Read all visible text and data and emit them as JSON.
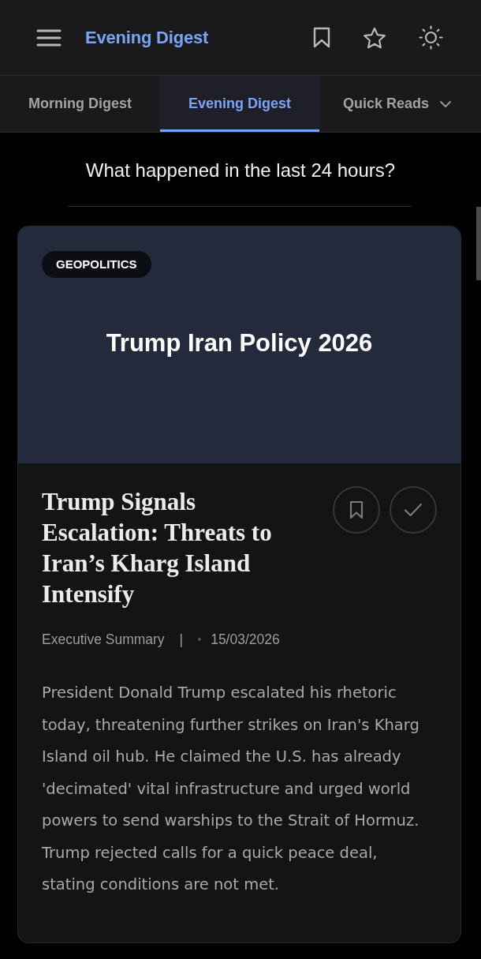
{
  "header": {
    "title": "Evening Digest"
  },
  "tabs": [
    {
      "label": "Morning Digest",
      "selected": false,
      "kind": "tab"
    },
    {
      "label": "Evening Digest",
      "selected": true,
      "kind": "tab"
    },
    {
      "label": "Quick Reads",
      "selected": false,
      "kind": "dropdown"
    }
  ],
  "subtitle": "What happened in the last 24 hours?",
  "article": {
    "category": "GEOPOLITICS",
    "cover_title": "Trump Iran Policy 2026",
    "headline": "Trump Signals Escalation: Threats to Iran’s Kharg Island Intensify",
    "source": "Executive Summary",
    "separator": "|",
    "date": "15/03/2026",
    "summary": "President Donald Trump escalated his rhetoric today, threatening further strikes on Iran's Kharg Island oil hub. He claimed the U.S. has already 'decimated' vital infrastructure and urged world powers to send warships to the Strait of Hormuz. Trump rejected calls for a quick peace deal, stating conditions are not met."
  }
}
